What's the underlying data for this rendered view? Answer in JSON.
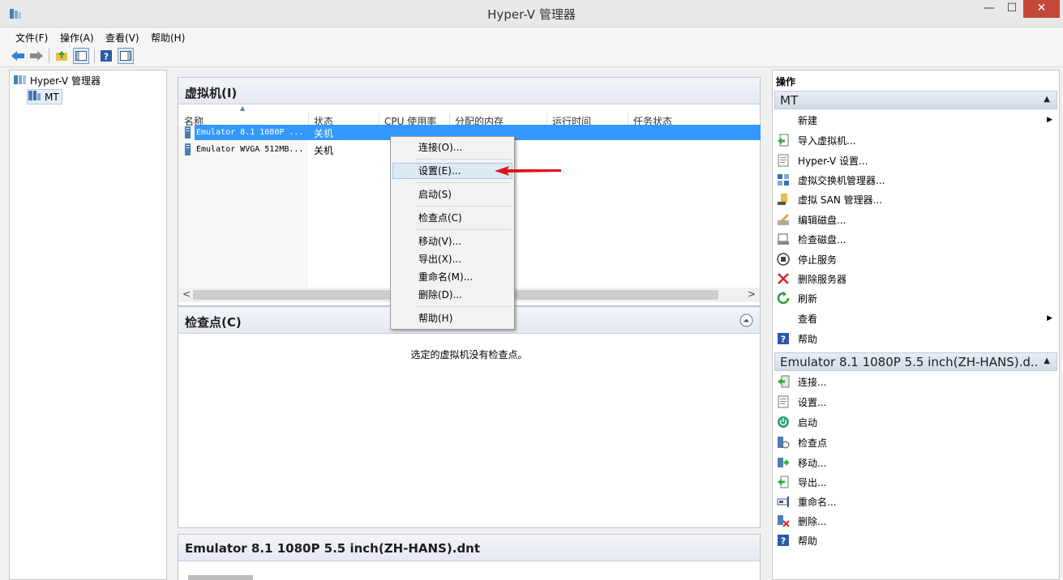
{
  "window": {
    "title": "Hyper-V 管理器",
    "minimize": "—",
    "maximize": "☐",
    "close": "✕"
  },
  "menu": [
    "文件(F)",
    "操作(A)",
    "查看(V)",
    "帮助(H)"
  ],
  "tree": {
    "root": "Hyper-V 管理器",
    "child": "MT"
  },
  "vm_panel": {
    "title": "虚拟机(I)",
    "columns": [
      "名称",
      "状态",
      "CPU 使用率",
      "分配的内存",
      "运行时间",
      "任务状态"
    ],
    "rows": [
      {
        "name": "Emulator 8.1 1080P ...",
        "state": "关机"
      },
      {
        "name": "Emulator WVGA 512MB...",
        "state": "关机"
      }
    ],
    "scroll_left": "<",
    "scroll_right": ">"
  },
  "checkpoint_panel": {
    "title": "检查点(C)",
    "empty_text": "选定的虚拟机没有检查点。"
  },
  "details_panel": {
    "title": "Emulator 8.1 1080P 5.5 inch(ZH-HANS).dnt"
  },
  "context_menu": [
    "连接(O)...",
    "设置(E)...",
    "启动(S)",
    "检查点(C)",
    "移动(V)...",
    "导出(X)...",
    "重命名(M)...",
    "删除(D)...",
    "帮助(H)"
  ],
  "actions": {
    "title": "操作",
    "section_host": "MT",
    "host_items": [
      "新建",
      "导入虚拟机...",
      "Hyper-V 设置...",
      "虚拟交换机管理器...",
      "虚拟 SAN 管理器...",
      "编辑磁盘...",
      "检查磁盘...",
      "停止服务",
      "删除服务器",
      "刷新",
      "查看",
      "帮助"
    ],
    "section_vm": "Emulator 8.1 1080P 5.5 inch(ZH-HANS).d...",
    "vm_items": [
      "连接...",
      "设置...",
      "启动",
      "检查点",
      "移动...",
      "导出...",
      "重命名...",
      "删除...",
      "帮助"
    ]
  },
  "colors": {
    "selection": "#3399ff",
    "arrow": "#e0141c",
    "close_button": "#c7463a"
  }
}
